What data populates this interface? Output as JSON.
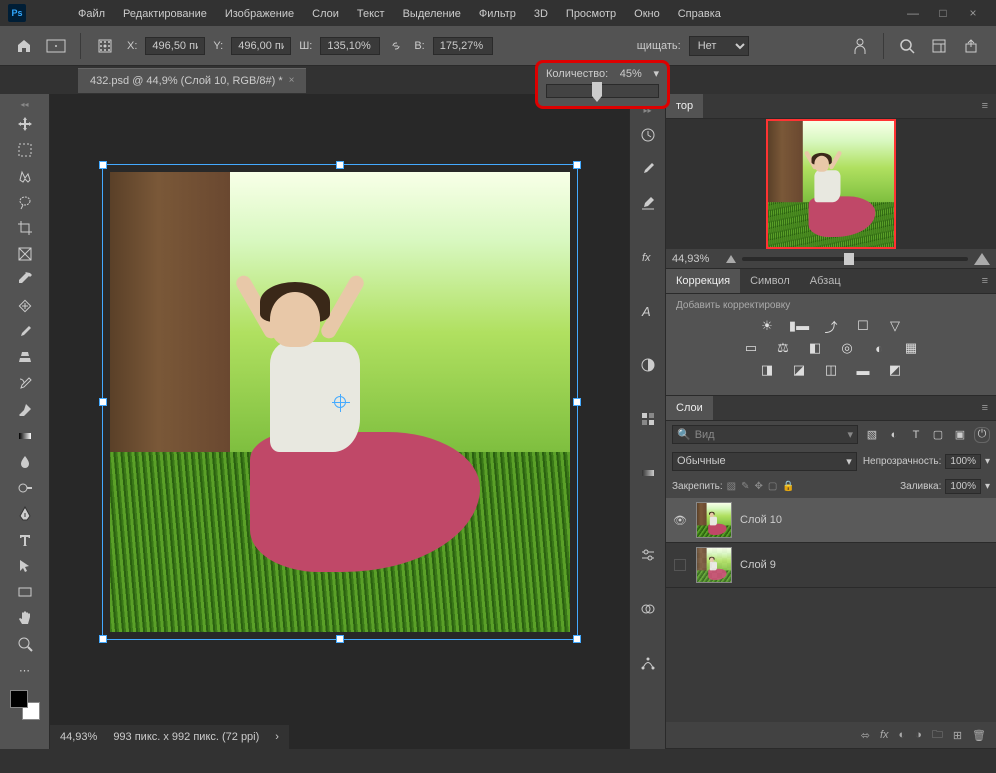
{
  "window": {
    "minimize": "—",
    "maximize": "□",
    "close": "×"
  },
  "menubar": [
    "Файл",
    "Редактирование",
    "Изображение",
    "Слои",
    "Текст",
    "Выделение",
    "Фильтр",
    "3D",
    "Просмотр",
    "Окно",
    "Справка"
  ],
  "optbar": {
    "x_label": "X:",
    "x_value": "496,50 пи",
    "y_label": "Y:",
    "y_value": "496,00 пи",
    "w_label": "Ш:",
    "w_value": "135,10%",
    "h_label": "В:",
    "h_value": "175,27%",
    "qty_label": "Количество:",
    "qty_value": "45%",
    "protect_label": "щищать:",
    "protect_value": "Нет"
  },
  "tab": {
    "title": "432.psd @ 44,9% (Слой 10, RGB/8#) *"
  },
  "navigator": {
    "tab": "тор",
    "zoom": "44,93%"
  },
  "adjustments": {
    "tabs": [
      "Коррекция",
      "Символ",
      "Абзац"
    ],
    "hint": "Добавить корректировку"
  },
  "layers_panel": {
    "tab": "Слои",
    "search_placeholder": "Вид",
    "blend_mode": "Обычные",
    "opacity_label": "Непрозрачность:",
    "opacity_value": "100%",
    "lock_label": "Закрепить:",
    "fill_label": "Заливка:",
    "fill_value": "100%",
    "layers": [
      {
        "name": "Слой 10",
        "visible": true,
        "active": true
      },
      {
        "name": "Слой 9",
        "visible": false,
        "active": false
      }
    ]
  },
  "status": {
    "zoom": "44,93%",
    "doc": "993 пикс. x 992 пикс. (72 ppi)"
  }
}
